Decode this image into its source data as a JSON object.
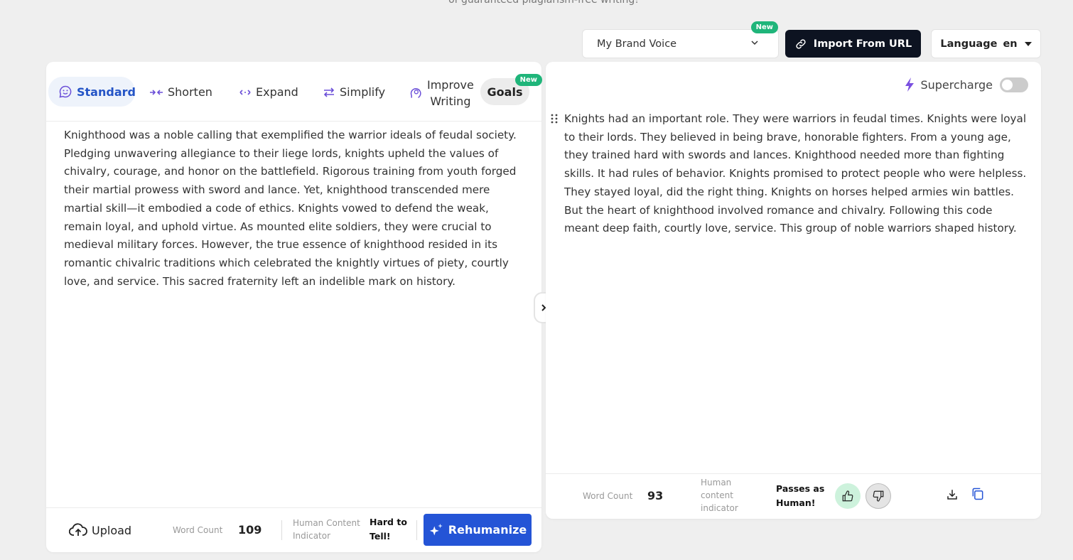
{
  "header": {
    "tagline": "of guaranteed plagiarism-free writing!"
  },
  "toolbar": {
    "brand_voice": "My Brand Voice",
    "brand_voice_badge": "New",
    "import_label": "Import From URL",
    "language_label": "Language",
    "language_value": "en"
  },
  "modes": {
    "standard": "Standard",
    "shorten": "Shorten",
    "expand": "Expand",
    "simplify": "Simplify",
    "improve_line1": "Improve",
    "improve_line2": "Writing",
    "goals": "Goals",
    "goals_badge": "New"
  },
  "input": {
    "text": "Knighthood was a noble calling that exemplified the warrior ideals of feudal society. Pledging unwavering allegiance to their liege lords, knights upheld the values of chivalry, courage, and honor on the battlefield. Rigorous training from youth forged their martial prowess with sword and lance. Yet, knighthood transcended mere martial skill—it embodied a code of ethics. Knights vowed to defend the weak, remain loyal, and uphold virtue. As mounted elite soldiers, they were crucial to medieval military forces. However, the true essence of knighthood resided in its romantic chivalric traditions which celebrated the knightly virtues of piety, courtly love, and service. This sacred fraternity left an indelible mark on history.",
    "upload_label": "Upload",
    "word_count_label": "Word Count",
    "word_count": "109",
    "hci_line1": "Human Content",
    "hci_line2": "Indicator",
    "hci_value_line1": "Hard to",
    "hci_value_line2": "Tell!",
    "rehumanize_label": "Rehumanize"
  },
  "output": {
    "supercharge_label": "Supercharge",
    "text": "Knights had an important role. They were warriors in feudal times. Knights were loyal to their lords. They believed in being brave, honorable fighters. From a young age, they trained hard with swords and lances. Knighthood needed more than fighting skills. It had rules of behavior. Knights promised to protect people who were helpless. They stayed loyal, did the right thing. Knights on horses helped armies win battles. But the heart of knighthood involved romance and chivalry. Following this code meant deep faith, courtly love, service. This group of noble warriors shaped history.",
    "word_count_label": "Word Count",
    "word_count": "93",
    "hci_line1": "Human",
    "hci_line2": "content",
    "hci_line3": "indicator",
    "hci_value_line1": "Passes as",
    "hci_value_line2": "Human!"
  },
  "colors": {
    "accent": "#2454d6",
    "dark_button": "#0d1321",
    "badge_green": "#1fb57a",
    "mode_icon": "#6b4fd8"
  }
}
